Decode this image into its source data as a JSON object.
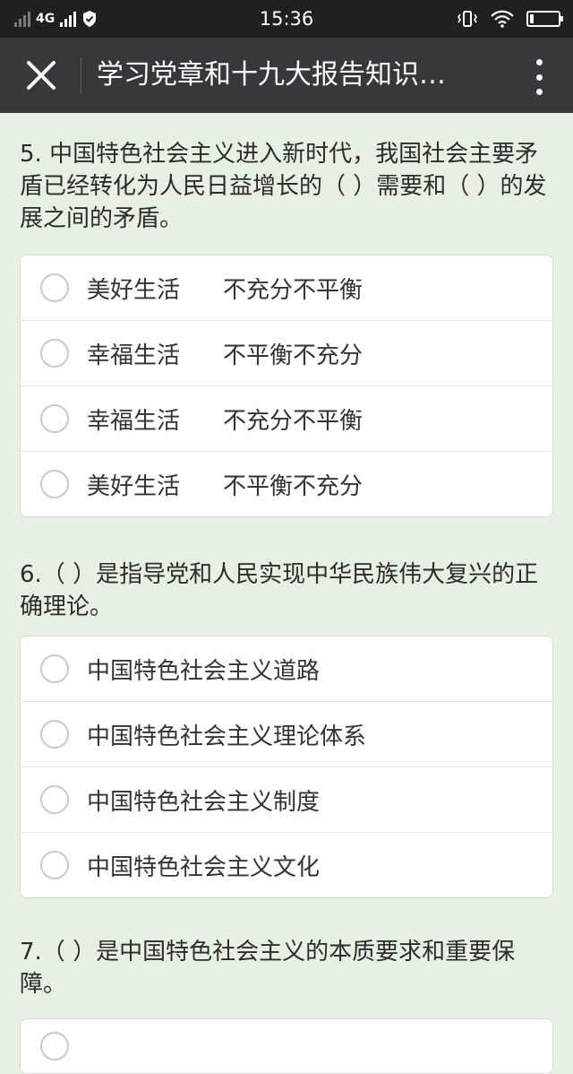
{
  "status": {
    "network": "4G",
    "time": "15:36"
  },
  "nav": {
    "title": "学习党章和十九大报告知识…"
  },
  "questions": [
    {
      "text": "5. 中国特色社会主义进入新时代，我国社会主要矛盾已经转化为人民日益增长的（ ）需要和（ ）的发展之间的矛盾。",
      "options": [
        {
          "a": "美好生活",
          "b": "不充分不平衡"
        },
        {
          "a": "幸福生活",
          "b": "不平衡不充分"
        },
        {
          "a": "幸福生活",
          "b": "不充分不平衡"
        },
        {
          "a": "美好生活",
          "b": "不平衡不充分"
        }
      ]
    },
    {
      "text": "6.（ ）是指导党和人民实现中华民族伟大复兴的正确理论。",
      "options": [
        {
          "a": "中国特色社会主义道路"
        },
        {
          "a": "中国特色社会主义理论体系"
        },
        {
          "a": "中国特色社会主义制度"
        },
        {
          "a": "中国特色社会主义文化"
        }
      ]
    },
    {
      "text": "7.（ ）是中国特色社会主义的本质要求和重要保障。",
      "options": []
    }
  ]
}
